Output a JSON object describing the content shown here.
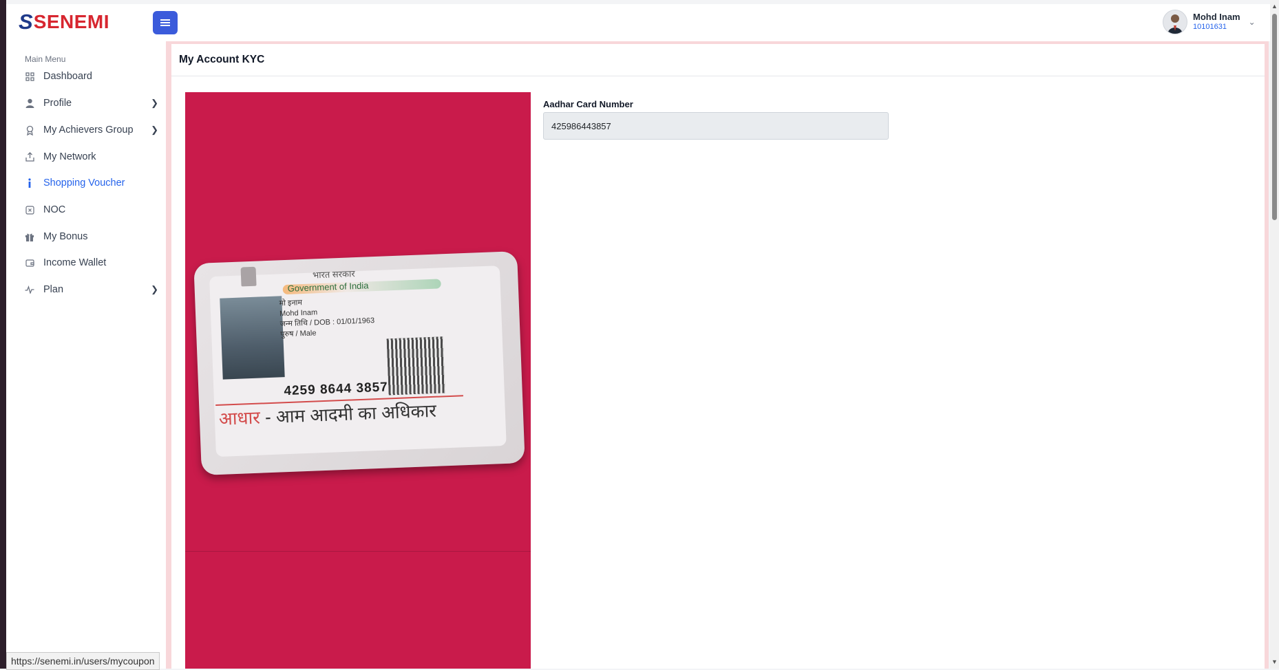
{
  "brand": {
    "mark": "S",
    "name": "SENEMI"
  },
  "header": {
    "user_name": "Mohd Inam",
    "user_id": "10101631"
  },
  "sidebar": {
    "section_label": "Main Menu",
    "items": [
      {
        "label": "Dashboard",
        "icon": "grid-icon",
        "has_submenu": false
      },
      {
        "label": "Profile",
        "icon": "user-icon",
        "has_submenu": true
      },
      {
        "label": "My Achievers Group",
        "icon": "award-icon",
        "has_submenu": true
      },
      {
        "label": "My Network",
        "icon": "share-icon",
        "has_submenu": false
      },
      {
        "label": "Shopping Voucher",
        "icon": "info-icon",
        "has_submenu": false,
        "active": true
      },
      {
        "label": "NOC",
        "icon": "x-square-icon",
        "has_submenu": false
      },
      {
        "label": "My Bonus",
        "icon": "gift-icon",
        "has_submenu": false
      },
      {
        "label": "Income Wallet",
        "icon": "wallet-icon",
        "has_submenu": false
      },
      {
        "label": "Plan",
        "icon": "activity-icon",
        "has_submenu": true
      }
    ]
  },
  "page": {
    "title": "My Account KYC",
    "aadhar_label": "Aadhar Card Number",
    "aadhar_value": "425986443857"
  },
  "id_card": {
    "gov_hindi": "भारत सरकार",
    "gov_english": "Government of India",
    "name_hindi": "मो इनाम",
    "name": "Mohd Inam",
    "dob": "जन्म तिथि / DOB : 01/01/1963",
    "gender": "पुरुष / Male",
    "number": "4259  8644  3857",
    "slogan_red": "आधार",
    "slogan_rest": " - आम आदमी का अधिकार"
  },
  "status_bar": {
    "url": "https://senemi.in/users/mycoupon"
  },
  "colors": {
    "accent": "#2563eb",
    "toggle": "#3b5bdb",
    "brand_red": "#d7262f",
    "photo_bg": "#c91b4b"
  }
}
